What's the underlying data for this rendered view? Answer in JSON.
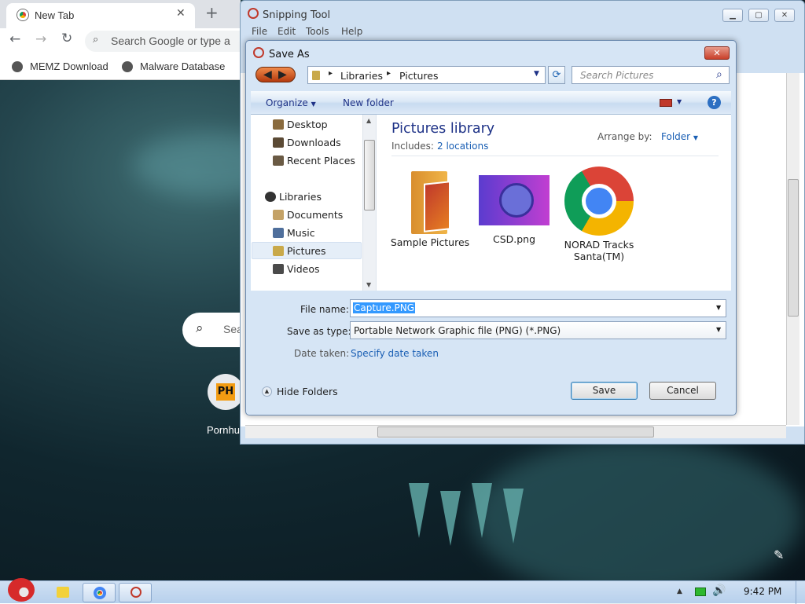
{
  "chrome": {
    "tab_title": "New Tab",
    "omnibox_placeholder": "Search Google or type a",
    "bookmarks": [
      "MEMZ Download",
      "Malware Database"
    ],
    "search_placeholder": "Sea",
    "shortcut_label": "Pornhu",
    "shortcut_icon_text": "PH"
  },
  "snipping_tool": {
    "title": "Snipping Tool",
    "menu": [
      "File",
      "Edit",
      "Tools",
      "Help"
    ]
  },
  "save_dialog": {
    "title": "Save As",
    "breadcrumb": [
      "Libraries",
      "Pictures"
    ],
    "search_placeholder": "Search Pictures",
    "toolbar": {
      "organize": "Organize",
      "new_folder": "New folder"
    },
    "nav_items": [
      "Desktop",
      "Downloads",
      "Recent Places",
      "Libraries",
      "Documents",
      "Music",
      "Pictures",
      "Videos"
    ],
    "library_title": "Pictures library",
    "includes_label": "Includes:",
    "includes_link": "2 locations",
    "arrange_label": "Arrange by:",
    "arrange_value": "Folder",
    "files": [
      {
        "name": "Sample Pictures",
        "icon": "folder-icon"
      },
      {
        "name": "CSD.png",
        "icon": "image-thumbnail"
      },
      {
        "name": "NORAD Tracks Santa(TM)",
        "icon": "chrome-icon"
      }
    ],
    "file_name_label": "File name:",
    "file_name_value": "Capture.PNG",
    "save_type_label": "Save as type:",
    "save_type_value": "Portable Network Graphic file (PNG) (*.PNG)",
    "date_label": "Date taken:",
    "date_link": "Specify date taken",
    "hide_folders": "Hide Folders",
    "save_button": "Save",
    "cancel_button": "Cancel"
  },
  "taskbar": {
    "clock": "9:42 PM"
  },
  "colors": {
    "accent": "#1a5fb4",
    "title_blue": "#1e3287",
    "selection": "#3399ff"
  }
}
